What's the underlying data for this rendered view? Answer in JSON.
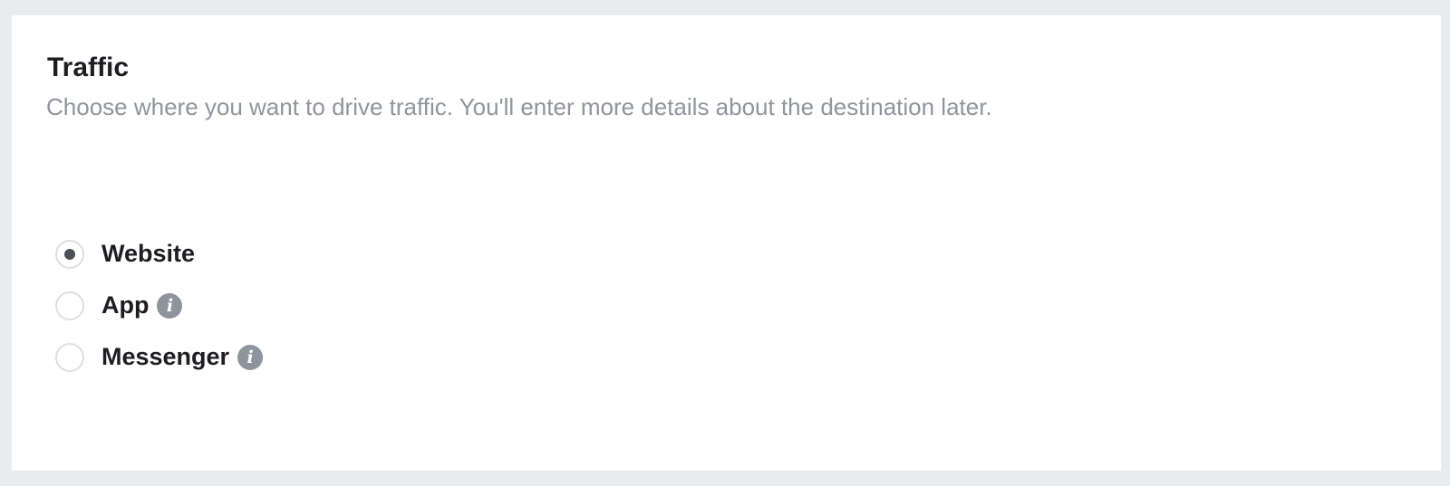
{
  "section": {
    "title": "Traffic",
    "subtitle": "Choose where you want to drive traffic. You'll enter more details about the destination later."
  },
  "options": [
    {
      "label": "Website",
      "selected": true,
      "has_info": false
    },
    {
      "label": "App",
      "selected": false,
      "has_info": true
    },
    {
      "label": "Messenger",
      "selected": false,
      "has_info": true
    }
  ],
  "icons": {
    "info": "info-icon"
  },
  "colors": {
    "background": "#e9ebee",
    "card": "#ffffff",
    "title": "#1c1e21",
    "subtitle": "#90949c",
    "radio_dot": "#4b4f56",
    "info_icon": "#8d949e"
  }
}
